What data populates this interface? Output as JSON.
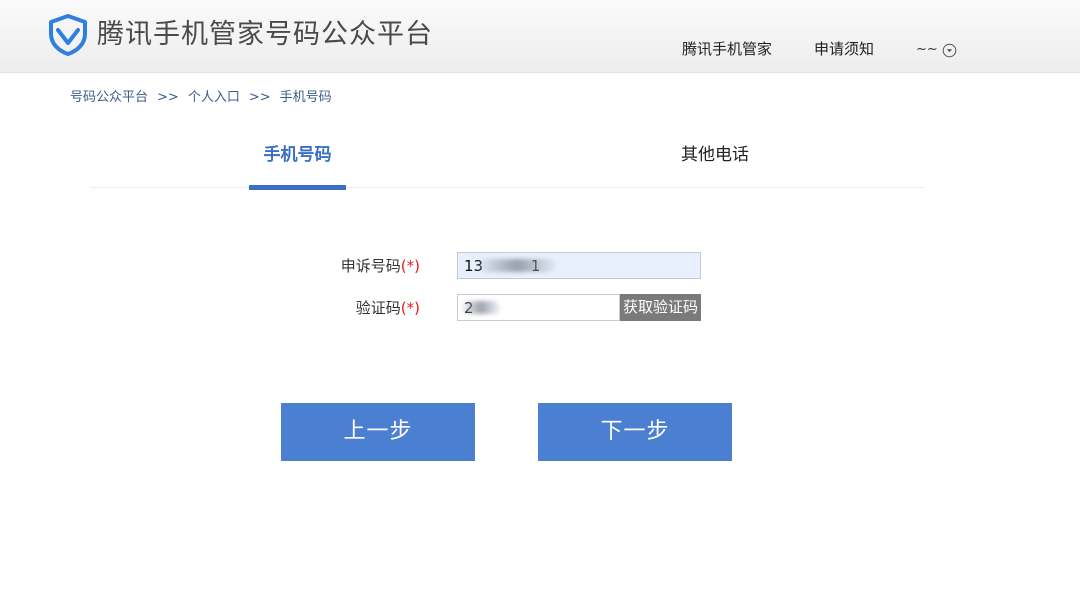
{
  "header": {
    "brand": "腾讯手机管家号码公众平台",
    "nav": [
      {
        "label": "腾讯手机管家"
      },
      {
        "label": "申请须知"
      }
    ],
    "user": {
      "name": "~~"
    }
  },
  "breadcrumb": {
    "items": [
      "号码公众平台",
      "个人入口",
      "手机号码"
    ],
    "separator": ">>"
  },
  "tabs": [
    {
      "label": "手机号码",
      "active": true
    },
    {
      "label": "其他电话",
      "active": false
    }
  ],
  "form": {
    "phone": {
      "label": "申诉号码",
      "required_mark": "(*)",
      "value": "13          1"
    },
    "code": {
      "label": "验证码",
      "required_mark": "(*)",
      "value": "2     "
    },
    "get_code_label": "获取验证码"
  },
  "buttons": {
    "prev": "上一步",
    "next": "下一步"
  },
  "colors": {
    "accent": "#3a6fc4",
    "button": "#4a7fd2",
    "required": "#e02020",
    "get_code_bg": "#7a7a7a",
    "logo": "#2f7fe0"
  }
}
